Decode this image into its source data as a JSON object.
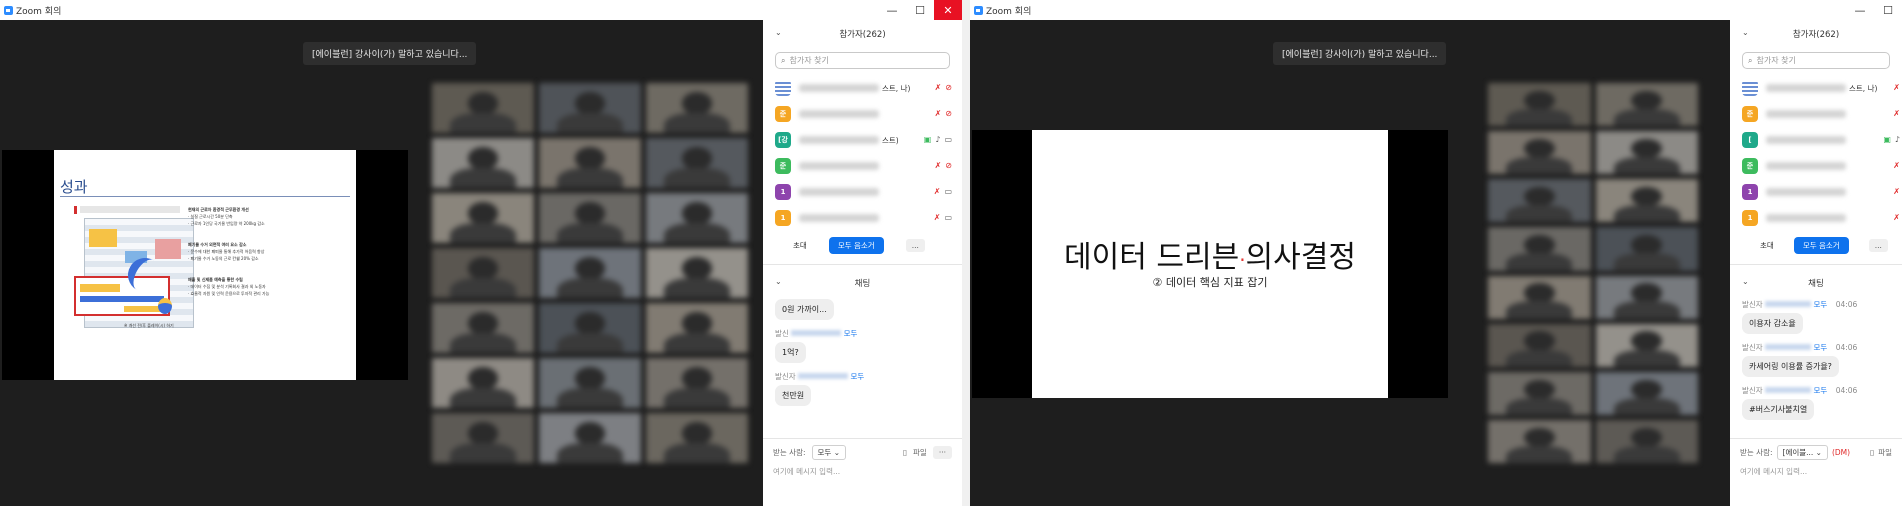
{
  "windows": [
    {
      "title": "Zoom 회의",
      "speaker_banner": "[에이블런] 강사이(가) 말하고 있습니다...",
      "slide": {
        "title": "성과",
        "caption": "※ 개선 전/후 플레이(시) 하기",
        "bullets": [
          "현재의 근로자 환경적 근무환경 개선",
          "· 실질 근로시간 50분 단축",
          "· 근로자 1인당 국기물 반입량 약 200kg 감소",
          "폐기물 수거 외면적 여러 요소 감소",
          "· 문수에 대한 폐퇴물 통해 추가적 어음력 향상",
          "· 폐기물 수거 노동의 근로 칸쉘 20% 감소",
          "매출 및 신제품 예측을 통한 수립",
          "· 데이터 수집 및 분석 기록회사 결과 외 노동자",
          "· 효율적 자원 및 인력 운용으로 투자적 관리 가능"
        ]
      },
      "panel": {
        "participants_title": "참가자(262)",
        "search_placeholder": "참가자 찾기",
        "participants": [
          {
            "avatar": "",
            "suffix": "스트, 나)",
            "color": "#6a8fd4"
          },
          {
            "avatar": "준",
            "suffix": "",
            "color": "#f5a623"
          },
          {
            "avatar": "[강",
            "suffix": "스트)",
            "color": "#1fa98a"
          },
          {
            "avatar": "준",
            "suffix": "",
            "color": "#3dbb5e"
          },
          {
            "avatar": "1",
            "suffix": "",
            "color": "#8e44ad"
          },
          {
            "avatar": "1",
            "suffix": "",
            "color": "#f5a623"
          }
        ],
        "invite_label": "초대",
        "mute_all_label": "모두 음소거",
        "more_label": "...",
        "chat_title": "채팅",
        "messages": [
          {
            "meta_from": "",
            "meta_to": "",
            "text": "0원 가까이..."
          },
          {
            "meta_from": "발신",
            "meta_to": "모두",
            "text": "1억?"
          },
          {
            "meta_from": "발신자",
            "meta_to": "모두",
            "text": "천만원"
          }
        ],
        "to_label": "받는 사람:",
        "to_value": "모두",
        "file_label": "파일",
        "input_placeholder": "여기에 메시지 입력..."
      }
    },
    {
      "title": "Zoom 회의",
      "speaker_banner": "[에이블런] 강사이(가) 말하고 있습니다...",
      "slide": {
        "title_part1": "데이터 드리븐",
        "title_part2": "의사결정",
        "subtitle": "② 데이터 핵심 지표 잡기"
      },
      "panel": {
        "participants_title": "참가자(262)",
        "search_placeholder": "참가자 찾기",
        "participants": [
          {
            "avatar": "",
            "suffix": "스트, 나)",
            "color": "#6a8fd4"
          },
          {
            "avatar": "준",
            "suffix": "",
            "color": "#f5a623"
          },
          {
            "avatar": "[",
            "suffix": "",
            "color": "#1fa98a"
          },
          {
            "avatar": "준",
            "suffix": "",
            "color": "#3dbb5e"
          },
          {
            "avatar": "1",
            "suffix": "",
            "color": "#8e44ad"
          },
          {
            "avatar": "1",
            "suffix": "",
            "color": "#f5a623"
          }
        ],
        "invite_label": "초대",
        "mute_all_label": "모두 음소거",
        "more_label": "...",
        "chat_title": "채팅",
        "messages": [
          {
            "meta_from": "발신자",
            "meta_to": "모두",
            "time": "04:06",
            "text": "이용자 감소율"
          },
          {
            "meta_from": "발신자",
            "meta_to": "모두",
            "time": "04:06",
            "text": "카세어링 이용률 증가율?"
          },
          {
            "meta_from": "발신자",
            "meta_to": "모두",
            "time": "04:06",
            "text": "#버스기사불치열"
          }
        ],
        "to_label": "받는 사람:",
        "to_value": "[에이블...",
        "dm_label": "(DM)",
        "file_label": "파일",
        "input_placeholder": "여기에 메시지 입력..."
      }
    }
  ],
  "colors": {
    "accent_blue": "#0e72ed",
    "muted_red": "#e02828",
    "close_red": "#e81123"
  }
}
